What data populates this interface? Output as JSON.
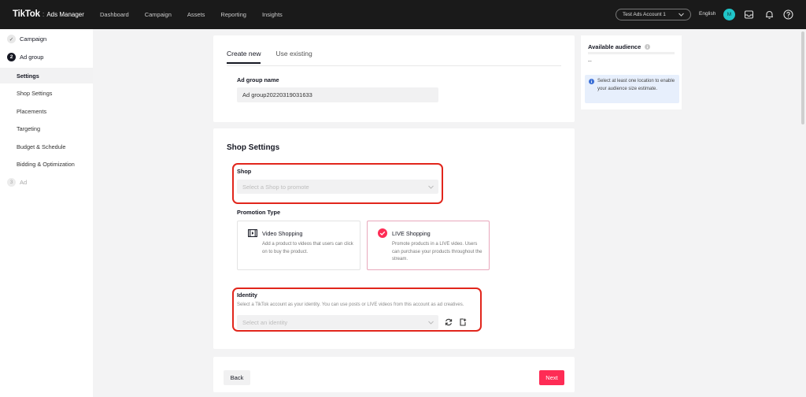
{
  "topbar": {
    "brand": "TikTok",
    "brand_sep": ":",
    "brand_sub": "Ads Manager",
    "nav": [
      "Dashboard",
      "Campaign",
      "Assets",
      "Reporting",
      "Insights"
    ],
    "account": "Test Ads Account 1",
    "language": "English",
    "avatar_letter": "M",
    "icons": [
      "inbox-icon",
      "bell-icon",
      "help-icon"
    ]
  },
  "sidebar": {
    "steps": [
      {
        "number": "✓",
        "label": "Campaign"
      },
      {
        "number": "2",
        "label": "Ad group"
      },
      {
        "number": "3",
        "label": "Ad"
      }
    ],
    "items": [
      "Settings",
      "Shop Settings",
      "Placements",
      "Targeting",
      "Budget & Schedule",
      "Bidding & Optimization"
    ]
  },
  "adgroup": {
    "tabs": [
      "Create new",
      "Use existing"
    ],
    "name_label": "Ad group name",
    "name_value": "Ad group20220319031633"
  },
  "shop_settings": {
    "title": "Shop Settings",
    "shop_label": "Shop",
    "shop_placeholder": "Select a Shop to promote",
    "promotion_label": "Promotion Type",
    "options": [
      {
        "title": "Video Shopping",
        "desc": "Add a product to videos that users can click on to buy the product."
      },
      {
        "title": "LIVE Shopping",
        "desc": "Promote products in a LIVE video. Users can purchase your products throughout the stream."
      }
    ],
    "identity_label": "Identity",
    "identity_desc": "Select a TikTok account as your identity. You can use posts or LIVE videos from this account as ad creatives.",
    "identity_placeholder": "Select an identity"
  },
  "footer": {
    "back": "Back",
    "next": "Next"
  },
  "audience": {
    "title": "Available audience",
    "value": "--",
    "info": "Select at least one location to enable your audience size estimate."
  },
  "colors": {
    "accent": "#fe2c55",
    "highlight": "#e1261c",
    "topbar": "#1a1a1a",
    "info_bg": "#e7effc"
  }
}
